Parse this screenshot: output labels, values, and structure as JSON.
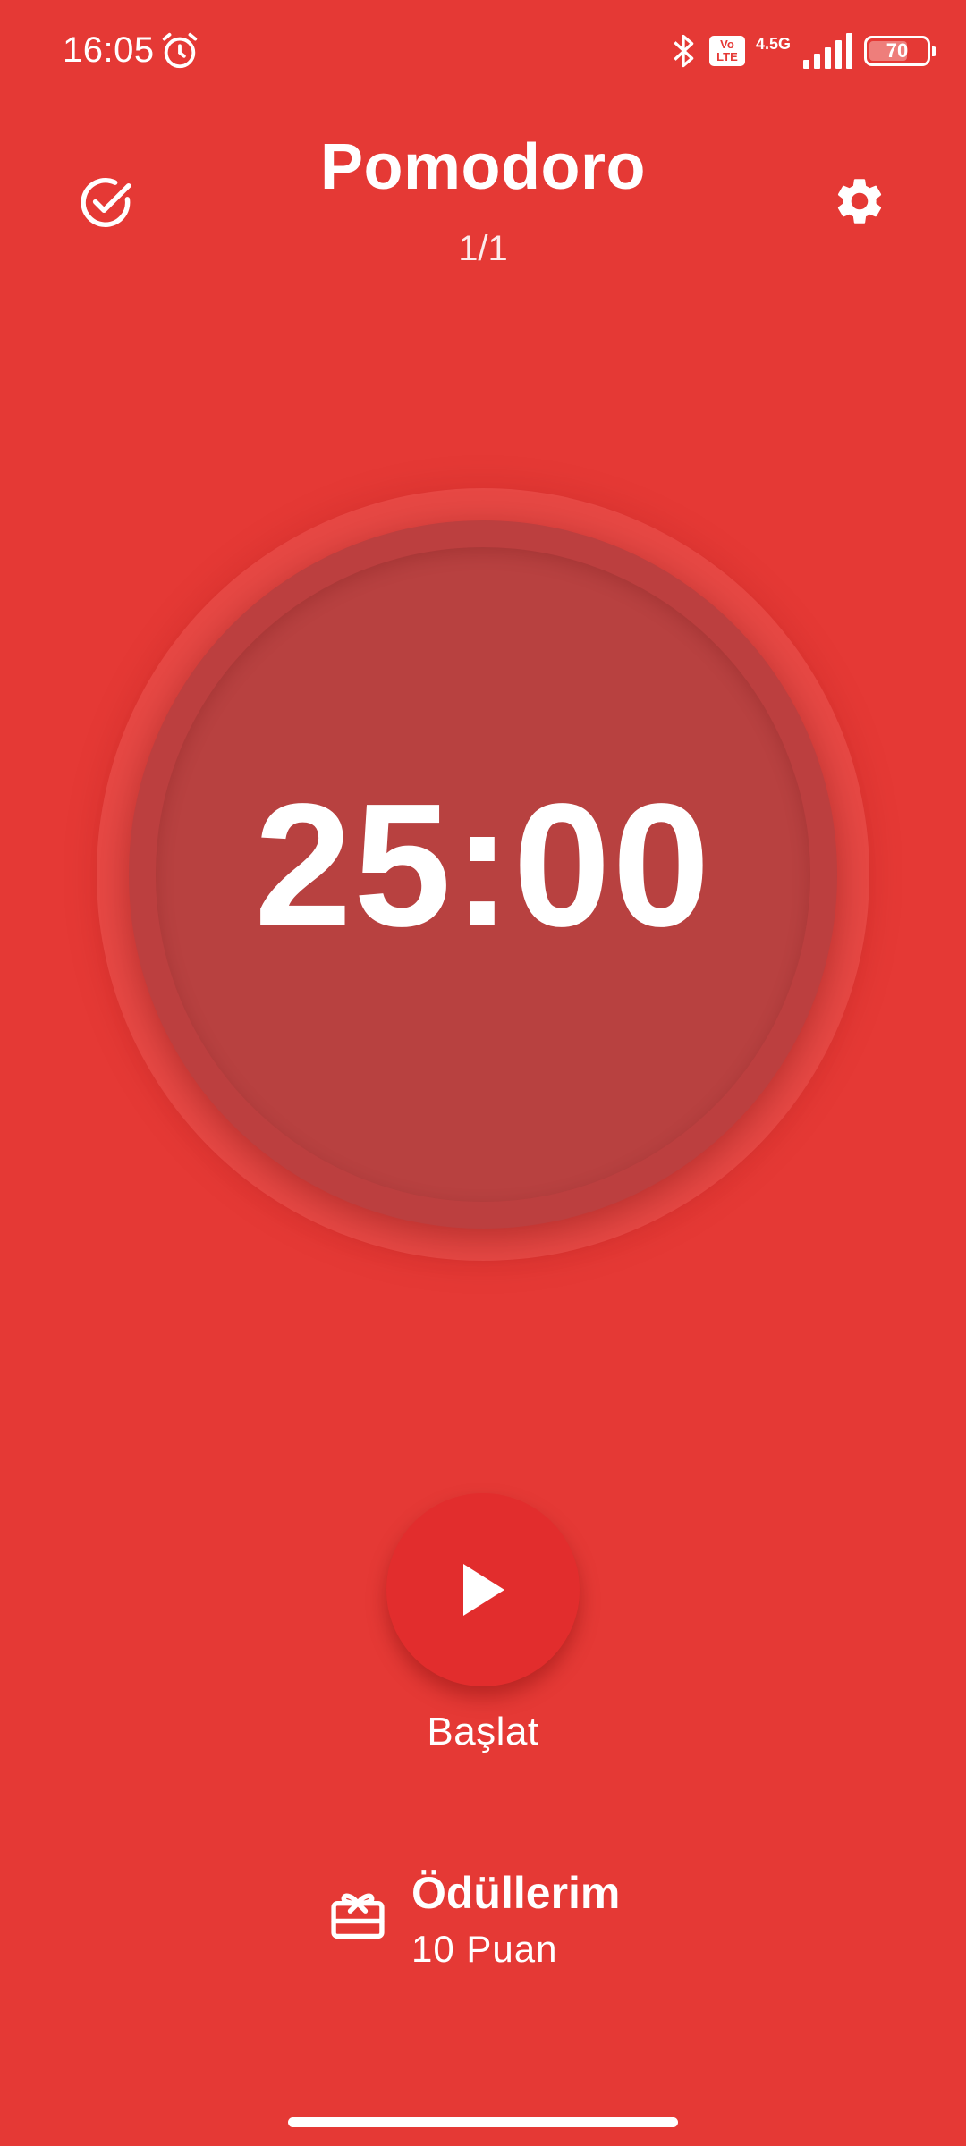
{
  "status_bar": {
    "time": "16:05",
    "network_badge": "Vo LTE",
    "network_type": "4.5G",
    "battery_level": "70",
    "icons": [
      "alarm-icon",
      "bluetooth-icon",
      "signal-icon",
      "battery-icon"
    ]
  },
  "header": {
    "title": "Pomodoro",
    "session_counter": "1/1",
    "icons": [
      "check-circle-icon",
      "gear-icon"
    ]
  },
  "timer": {
    "time": "25:00"
  },
  "start": {
    "label": "Başlat",
    "icon": "play-icon"
  },
  "rewards": {
    "title": "Ödüllerim",
    "points": "10 Puan",
    "icon": "gift-icon"
  },
  "colors": {
    "background": "#E53935",
    "timer_circle": "#B84140",
    "foreground": "#FFFFFF"
  },
  "battery": {
    "fill_fraction": 0.7
  }
}
